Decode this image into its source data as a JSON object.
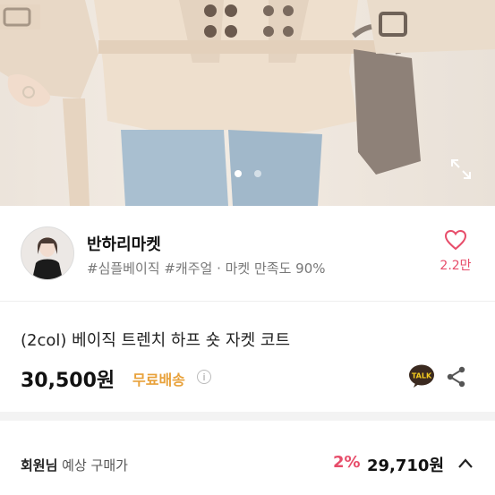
{
  "shop": {
    "name": "반하리마켓",
    "tags": "#심플베이직 #캐주얼 · 마켓 만족도 90%",
    "like_count": "2.2만"
  },
  "product": {
    "title": "(2col) 베이직 트렌치 하프 숏 자켓 코트",
    "price": "30,500원",
    "shipping": "무료배송",
    "talk_label": "TALK"
  },
  "member": {
    "label_strong": "회원님",
    "label_rest": " 예상 구매가",
    "discount": "2%",
    "price": "29,710원"
  },
  "colors": {
    "accent_pink": "#e74d6a",
    "shipping_orange": "#e8a13a",
    "talk_yellow": "#f5cc1f"
  },
  "gallery": {
    "dots_total": 2,
    "active_dot": 0
  }
}
